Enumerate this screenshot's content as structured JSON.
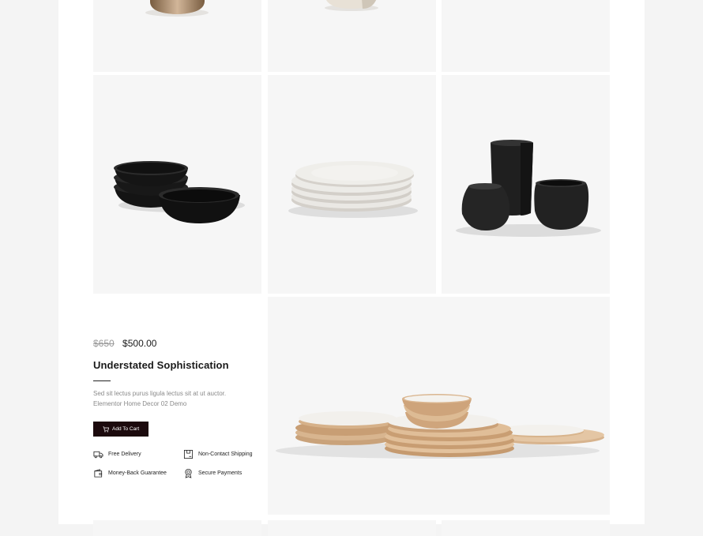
{
  "product": {
    "old_price": "$650",
    "new_price": "$500.00",
    "title": "Understated Sophistication",
    "description": "Sed sit lectus purus ligula lectus sit at ut auctor. Elementor Home Decor 02 Demo",
    "add_to_cart_label": "Add To Cart"
  },
  "features": [
    {
      "icon": "truck-icon",
      "label": "Free Delivery"
    },
    {
      "icon": "box-icon",
      "label": "Non-Contact Shipping"
    },
    {
      "icon": "wallet-icon",
      "label": "Money-Back Guarantee"
    },
    {
      "icon": "badge-icon",
      "label": "Secure Payments"
    }
  ],
  "gallery": [
    {
      "subject": "tan ceramic vase"
    },
    {
      "subject": "speckled stone vase"
    },
    {
      "subject": "empty tile"
    },
    {
      "subject": "black bowls stack"
    },
    {
      "subject": "white plates stack"
    },
    {
      "subject": "black vases trio"
    },
    {
      "subject": "tan dinnerware set"
    }
  ],
  "colors": {
    "button_bg": "#1c0a0d",
    "tile_bg": "#f6f6f6",
    "page_bg": "#ffffff",
    "outer_bg": "#f4f4f4"
  }
}
